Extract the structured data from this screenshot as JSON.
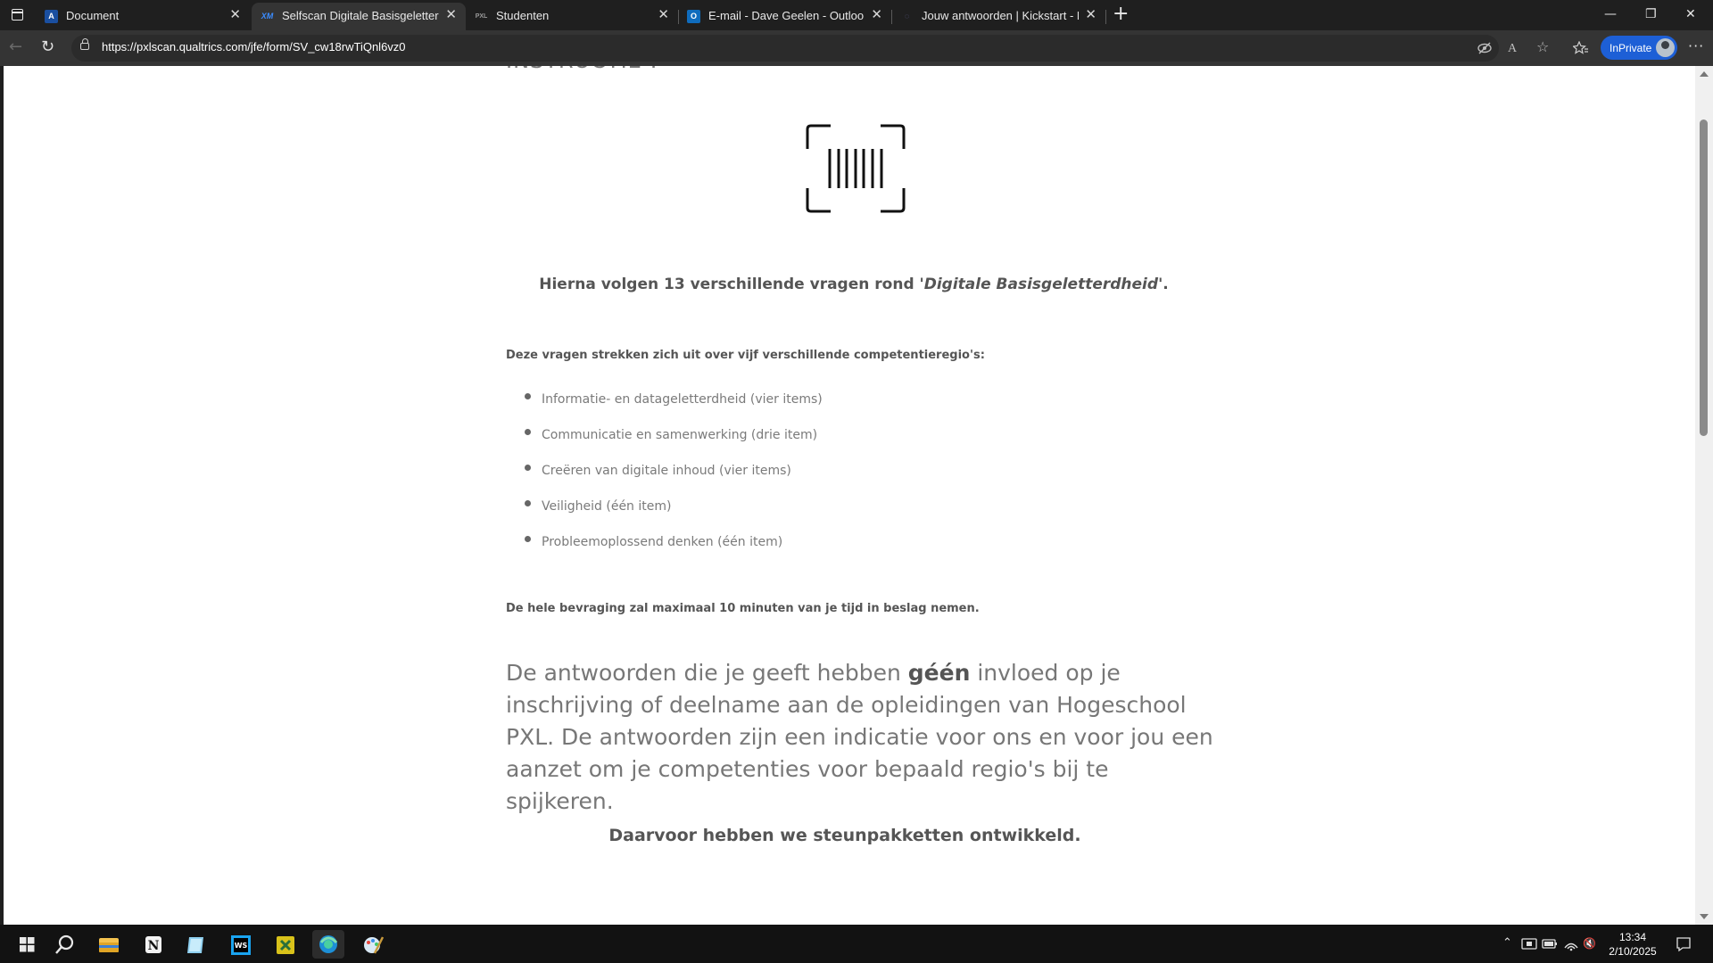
{
  "browser": {
    "tabs": [
      {
        "title": "Document",
        "favicon": "A",
        "favicon_color": "#1a4fa0",
        "active": false
      },
      {
        "title": "Selfscan Digitale Basisgeletterdhe",
        "favicon": "XM",
        "favicon_color": "#3b8cff",
        "active": true
      },
      {
        "title": "Studenten",
        "favicon": "PXL",
        "favicon_color": "#9a9a9a",
        "active": false
      },
      {
        "title": "E-mail - Dave Geelen - Outlook",
        "favicon": "O",
        "favicon_color": "#0f6cbd",
        "active": false
      },
      {
        "title": "Jouw antwoorden | Kickstart - Ler",
        "favicon": "◌",
        "favicon_color": "#3a3a6a",
        "active": false
      }
    ],
    "close_glyph": "✕",
    "new_tab_glyph": "+",
    "url": "https://pxlscan.qualtrics.com/jfe/form/SV_cw18rwTiQnl6vz0",
    "inprivate_label": "InPrivate",
    "window_controls": {
      "minimize": "—",
      "restore": "❐",
      "close": "✕"
    },
    "nav_glyphs": {
      "back": "←",
      "reload": "↻",
      "more": "···"
    }
  },
  "survey": {
    "cut_heading": "INSTRUCTIE :",
    "intro_prefix": "Hierna volgen 13 verschillende vragen rond '",
    "intro_italic": "Digitale Basisgeletterdheid",
    "intro_suffix": "'.",
    "subheading": "Deze vragen strekken zich uit over vijf verschillende competentieregio's:",
    "regions": [
      "Informatie- en datageletterdheid (vier items)",
      "Communicatie en samenwerking (drie item)",
      "Creëren van digitale inhoud (vier items)",
      "Veiligheid (één item)",
      "Probleemoplossend denken (één item)"
    ],
    "time_note": "De hele bevraging zal maximaal 10 minuten van je tijd in beslag nemen.",
    "big_prefix": "De antwoorden die je geeft hebben ",
    "big_bold": "géén",
    "big_suffix": " invloed op je inschrijving of deelname aan de opleidingen van Hogeschool PXL. De antwoorden zijn een indicatie voor ons en voor jou een aanzet om je competenties voor bepaald regio's bij te spijkeren.",
    "outro": "Daarvoor hebben we steunpakketten ontwikkeld."
  },
  "taskbar": {
    "time": "13:34",
    "date": "2/10/2025",
    "apps": [
      "start-icon",
      "search-icon",
      "file-explorer-icon",
      "notion-icon",
      "notepad-icon",
      "webstorm-icon",
      "excel-icon",
      "edge-icon",
      "paint-icon"
    ],
    "tray": {
      "chevron": "⌃",
      "speaker_muted": "🔇"
    }
  },
  "colors": {
    "accent": "#1d5fd6",
    "page_bg": "#ffffff",
    "chrome_bg": "#1f1f1f"
  }
}
